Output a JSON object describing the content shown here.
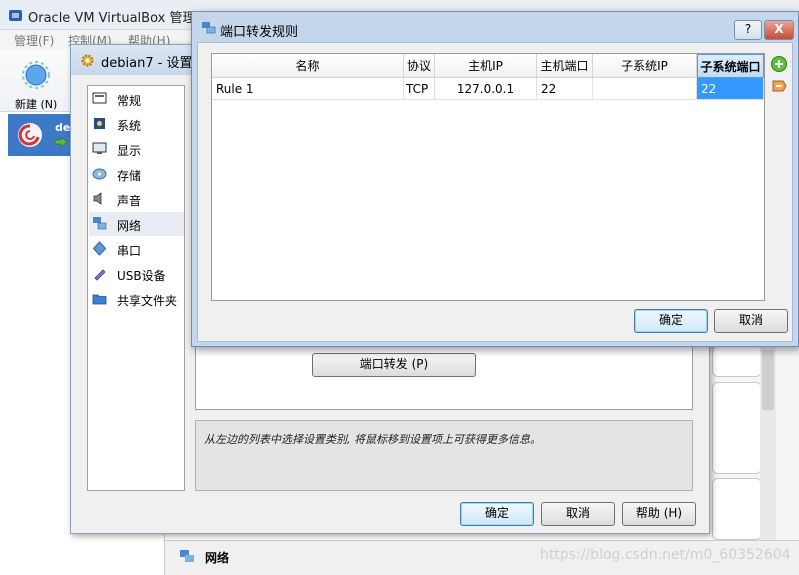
{
  "main": {
    "title": "Oracle VM VirtualBox 管理器",
    "menu": [
      "管理(F)",
      "控制(M)",
      "帮助(H)"
    ],
    "toolbar_new": "新建 (N)",
    "vm_name": "de",
    "bottom_section": "网络"
  },
  "settings": {
    "title": "debian7 - 设置",
    "categories": [
      {
        "label": "常规",
        "icon": "general-icon"
      },
      {
        "label": "系统",
        "icon": "system-chip-icon"
      },
      {
        "label": "显示",
        "icon": "monitor-icon"
      },
      {
        "label": "存储",
        "icon": "disk-icon"
      },
      {
        "label": "声音",
        "icon": "speaker-icon"
      },
      {
        "label": "网络",
        "icon": "network-icon"
      },
      {
        "label": "串口",
        "icon": "serial-port-icon"
      },
      {
        "label": "USB设备",
        "icon": "usb-icon"
      },
      {
        "label": "共享文件夹",
        "icon": "folder-icon"
      }
    ],
    "selected_category": "网络",
    "port_forward_button": "端口转发 (P)",
    "info_text": "从左边的列表中选择设置类别, 将鼠标移到设置项上可获得更多信息。",
    "ok": "确定",
    "cancel": "取消",
    "help": "帮助 (H)"
  },
  "port_forwarding": {
    "title": "端口转发规则",
    "help_btn": "?",
    "close_btn": "X",
    "columns": [
      "名称",
      "协议",
      "主机IP",
      "主机端口",
      "子系统IP",
      "子系统端口"
    ],
    "active_column": "子系统端口",
    "rows": [
      {
        "name": "Rule 1",
        "protocol": "TCP",
        "host_ip": "127.0.0.1",
        "host_port": "22",
        "guest_ip": "",
        "guest_port": "22"
      }
    ],
    "ok": "确定",
    "cancel": "取消"
  },
  "watermark": "https://blog.csdn.net/m0_60352604",
  "colors": {
    "selection": "#3399ff",
    "dialog_frame": "#c4d6ec",
    "vm_item": "#3d79c7"
  }
}
